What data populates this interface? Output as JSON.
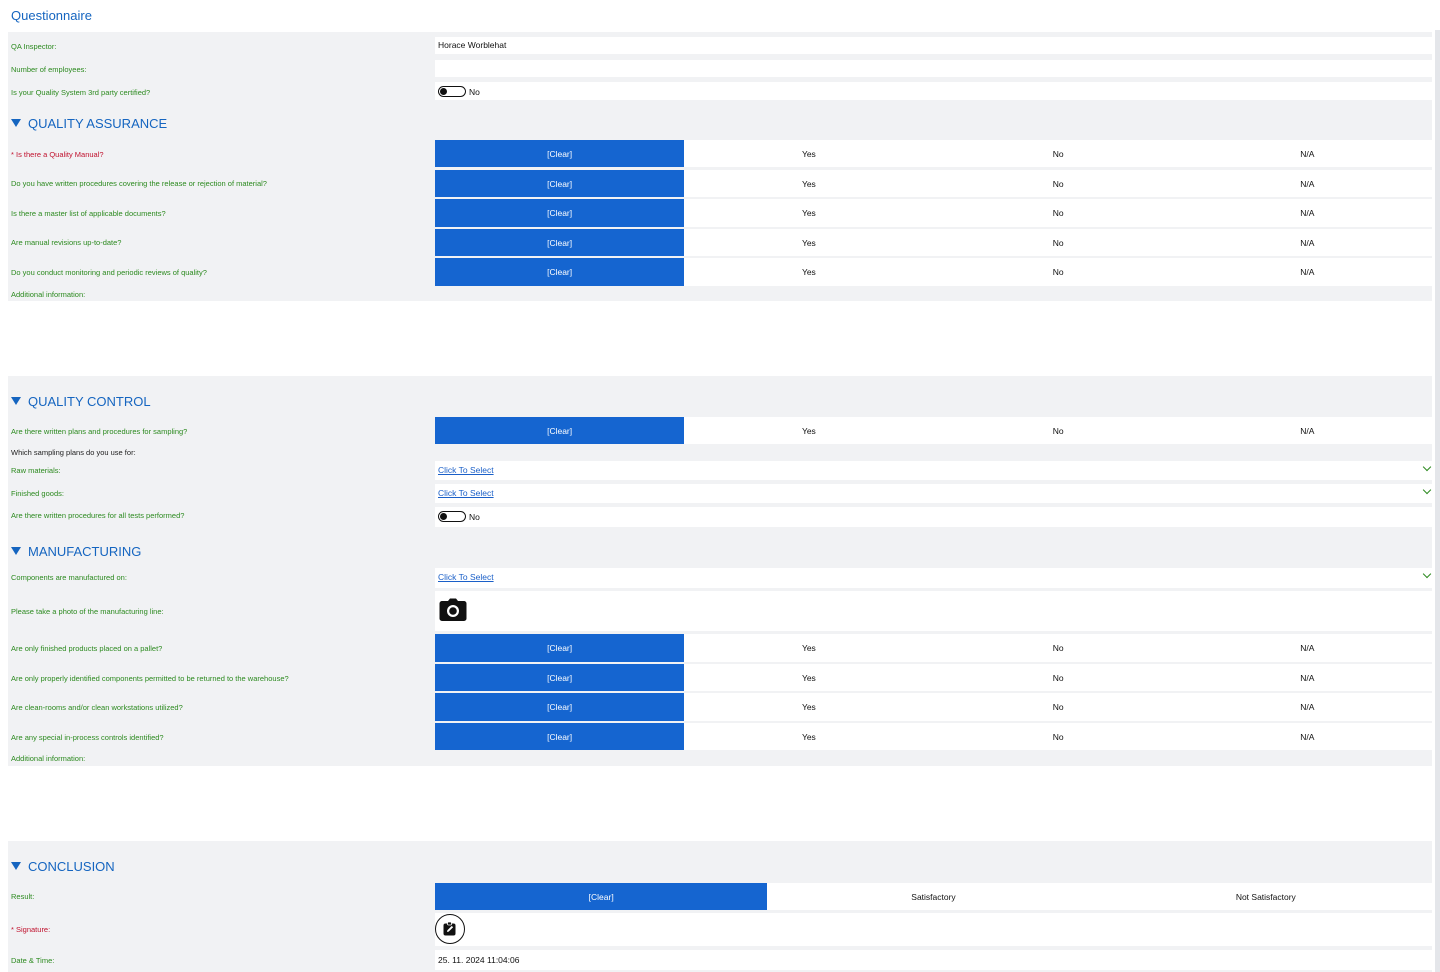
{
  "app_title": "Questionnaire",
  "header_fields": {
    "qa_inspector_label": "QA Inspector:",
    "qa_inspector_value": "Horace Worblehat",
    "employees_label": "Number of employees:",
    "employees_value": "",
    "certified_label": "Is your Quality System 3rd party certified?",
    "certified_value": "No"
  },
  "segments": {
    "clear": "[Clear]",
    "yes": "Yes",
    "no": "No",
    "na": "N/A"
  },
  "quality_assurance": {
    "title": "QUALITY ASSURANCE",
    "questions": [
      "* Is there a Quality Manual?",
      "Do you have written procedures covering the release or rejection of material?",
      "Is there a master list of applicable documents?",
      "Are manual revisions up-to-date?",
      "Do you conduct monitoring and periodic reviews of quality?"
    ],
    "additional_label": "Additional information:"
  },
  "quality_control": {
    "title": "QUALITY CONTROL",
    "q_sampling": "Are there written plans and procedures for sampling?",
    "which_plans_label": "Which sampling plans do you use for:",
    "raw_label": "Raw materials:",
    "raw_value": "Click To Select",
    "finished_label": "Finished goods:",
    "finished_value": "Click To Select",
    "tests_label": "Are there written procedures for all tests performed?",
    "tests_value": "No"
  },
  "manufacturing": {
    "title": "MANUFACTURING",
    "components_label": "Components are manufactured on:",
    "components_value": "Click To Select",
    "photo_label": "Please take a photo of the manufacturing line:",
    "questions": [
      "Are only finished products placed on a pallet?",
      "Are only properly identified components permitted to be returned to the warehouse?",
      "Are clean-rooms and/or clean workstations utilized?",
      "Are any special in-process controls identified?"
    ],
    "additional_label": "Additional information:"
  },
  "conclusion": {
    "title": "CONCLUSION",
    "result_label": "Result:",
    "result_options": [
      "[Clear]",
      "Satisfactory",
      "Not Satisfactory"
    ],
    "signature_label": "* Signature:",
    "datetime_label": "Date & Time:",
    "datetime_value": "25. 11. 2024 11:04:06"
  },
  "colors": {
    "accent": "#1565c0",
    "selected_segment": "#1565d0",
    "label_green": "#2c8a1f",
    "required_red": "#c0112d",
    "panel_bg": "#f1f2f4"
  },
  "icons": [
    "collapse-triangle-icon",
    "camera-icon",
    "signature-icon",
    "chevron-down-icon"
  ]
}
